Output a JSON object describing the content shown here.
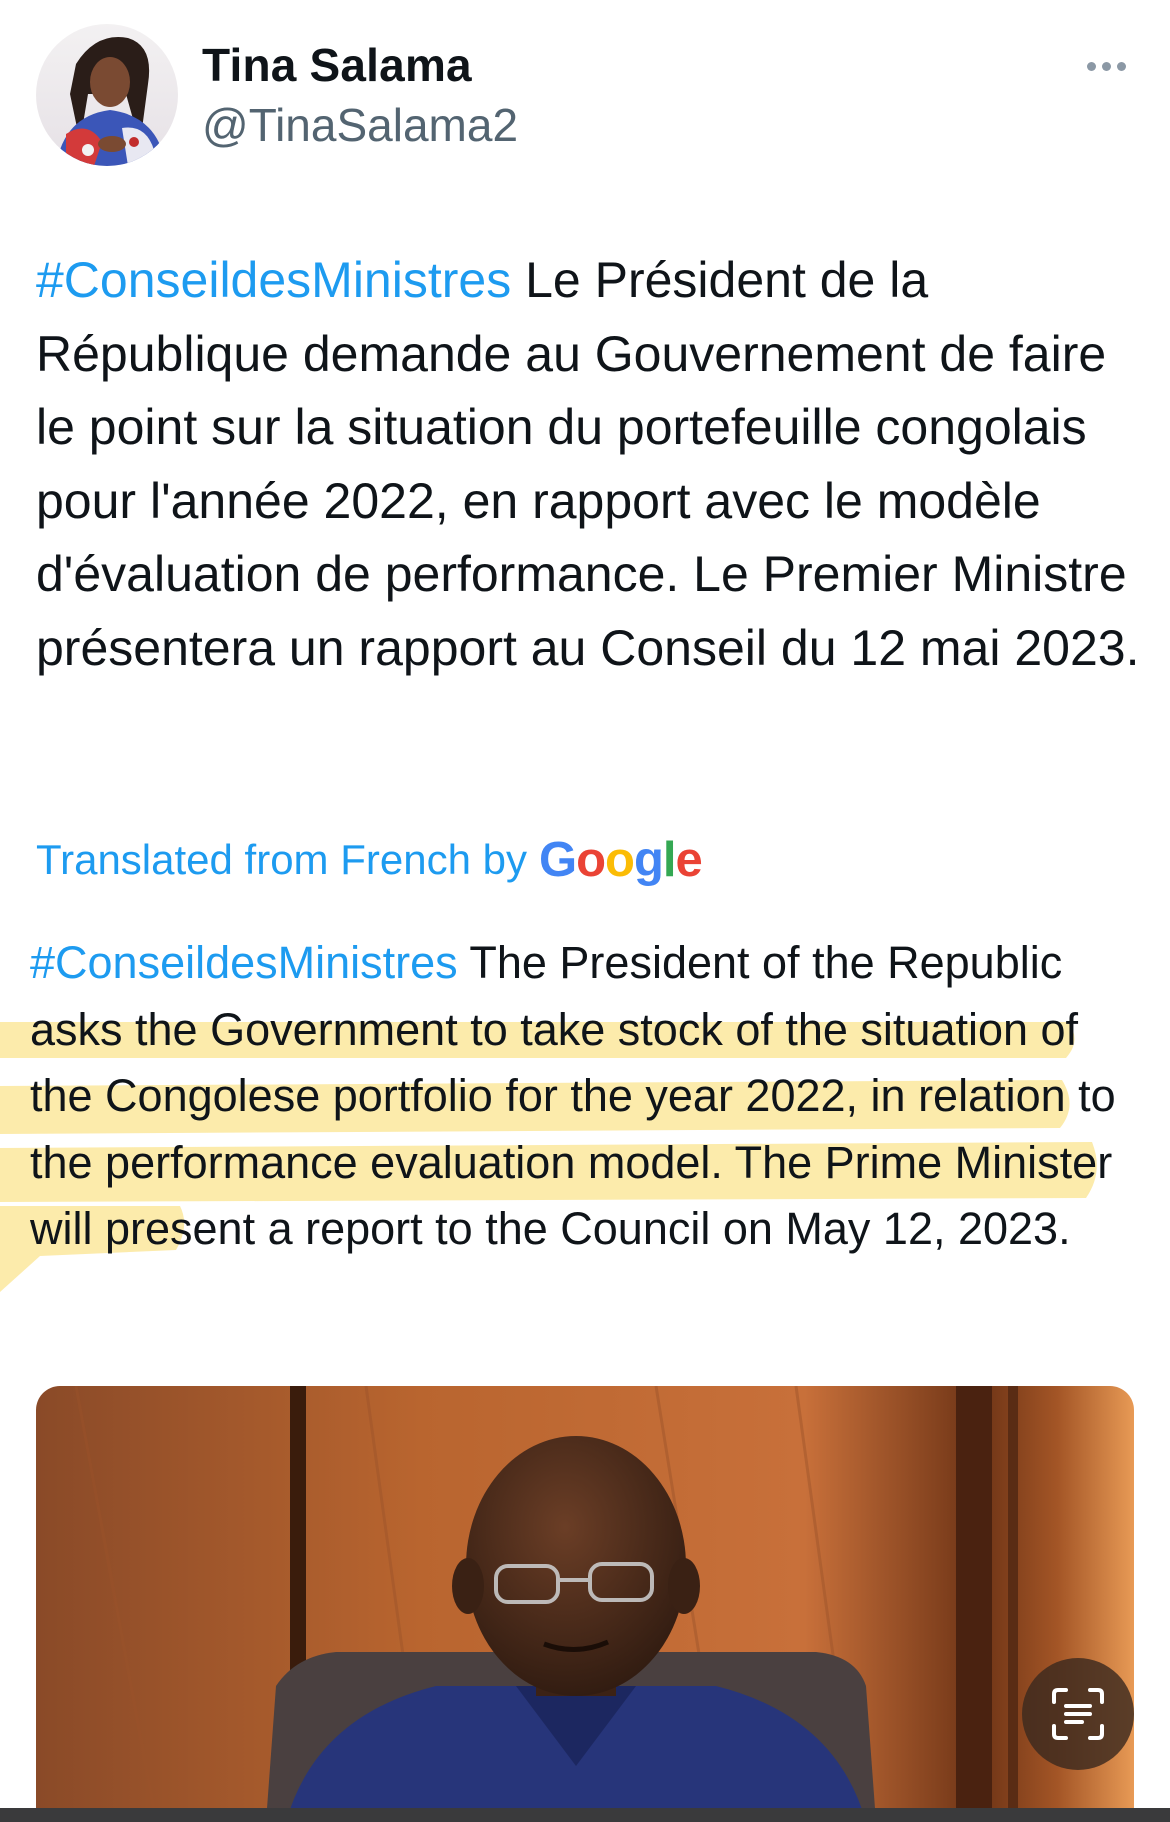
{
  "author": {
    "display_name": "Tina Salama",
    "handle": "@TinaSalama2",
    "avatar_icon": "profile-photo"
  },
  "tweet": {
    "original": {
      "hashtag": "#ConseildesMinistres",
      "text": " Le Président de la République demande au Gouvernement de faire le point sur la situation du portefeuille congolais pour l'année 2022, en rapport avec le modèle d'évaluation de performance. Le Premier Ministre présentera un rapport au Conseil du 12 mai 2023."
    },
    "translation": {
      "label": "Translated from French by",
      "provider": "Google",
      "hashtag": "#ConseildesMinistres",
      "text": " The President of the Republic asks the Government to take stock of the situation of the Congolese portfolio for the year 2022, in relation to the performance evaluation model. The Prime Minister will present a report to the Council on May 12, 2023."
    },
    "media": {
      "image_icon": "photo-man-seated-in-blue-suit"
    }
  },
  "controls": {
    "more_icon": "more-horizontal-icon",
    "live_text_icon": "live-text-scan-icon"
  },
  "colors": {
    "link": "#1d9bf0",
    "text": "#0f1419",
    "secondary": "#536471",
    "highlight": "#fbe79a",
    "google_blue": "#4285F4",
    "google_red": "#EA4335",
    "google_yellow": "#FBBC05",
    "google_green": "#34A853"
  }
}
